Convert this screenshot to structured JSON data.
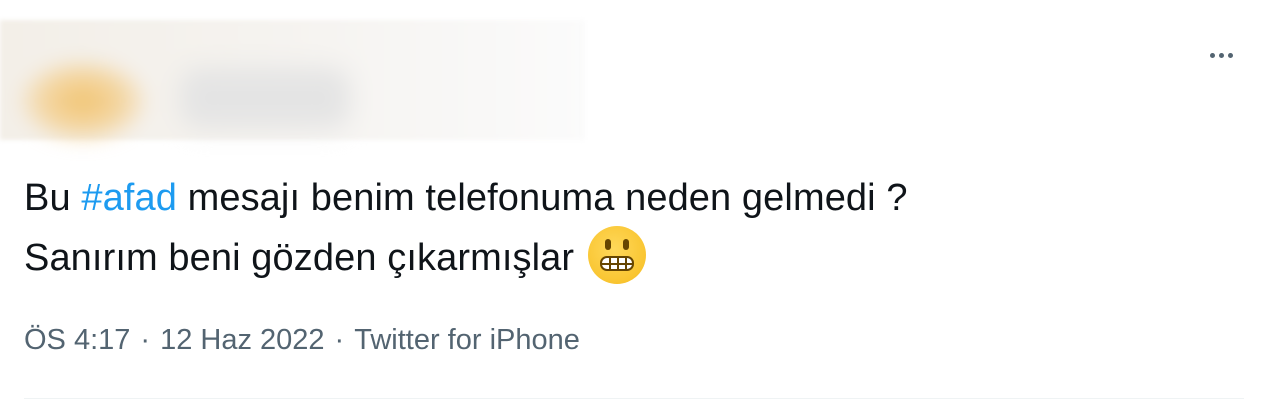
{
  "tweet": {
    "text_line1_prefix": "Bu ",
    "hashtag": "#afad",
    "text_line1_suffix": " mesajı benim telefonuma neden gelmedi ?",
    "text_line2": "Sanırım beni gözden çıkarmışlar",
    "emoji": "grimacing-face",
    "time": "ÖS 4:17",
    "date": "12 Haz 2022",
    "separator": "·",
    "source": "Twitter for iPhone"
  },
  "colors": {
    "text": "#0f1419",
    "link": "#1d9bf0",
    "meta": "#536471"
  },
  "icons": {
    "more": "more-horizontal-icon"
  }
}
